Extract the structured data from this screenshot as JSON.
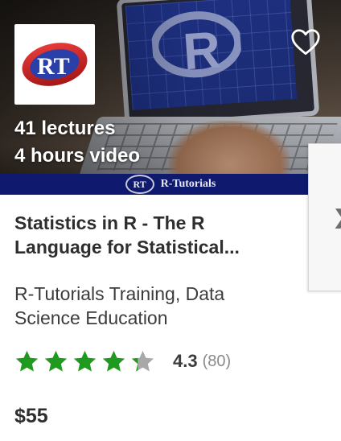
{
  "course": {
    "lectures": "41 lectures",
    "duration": "4 hours video",
    "title_line1": "Statistics in R - The R",
    "title_line2": "Language for Statistical...",
    "instructor_line1": "R-Tutorials Training, Data",
    "instructor_line2": "Science Education",
    "rating": "4.3",
    "rating_count": "(80)",
    "rating_value": 4.3,
    "max_rating": 5,
    "price": "$55"
  },
  "hero": {
    "brand_mark": "RT",
    "brand_name": "R-Tutorials",
    "thumbnail_logo_text": "RT",
    "screen_logo_text": "R"
  },
  "icons": {
    "favorite": "heart-outline-icon",
    "star": "star-icon",
    "side_glyph": "close-icon"
  },
  "side_card": {
    "glyph": "X"
  },
  "colors": {
    "star_filled": "#1e9b1e",
    "star_empty": "#a8a8a8",
    "brand_bar": "#0f1a6e",
    "text_dark": "#2e2e2e"
  }
}
